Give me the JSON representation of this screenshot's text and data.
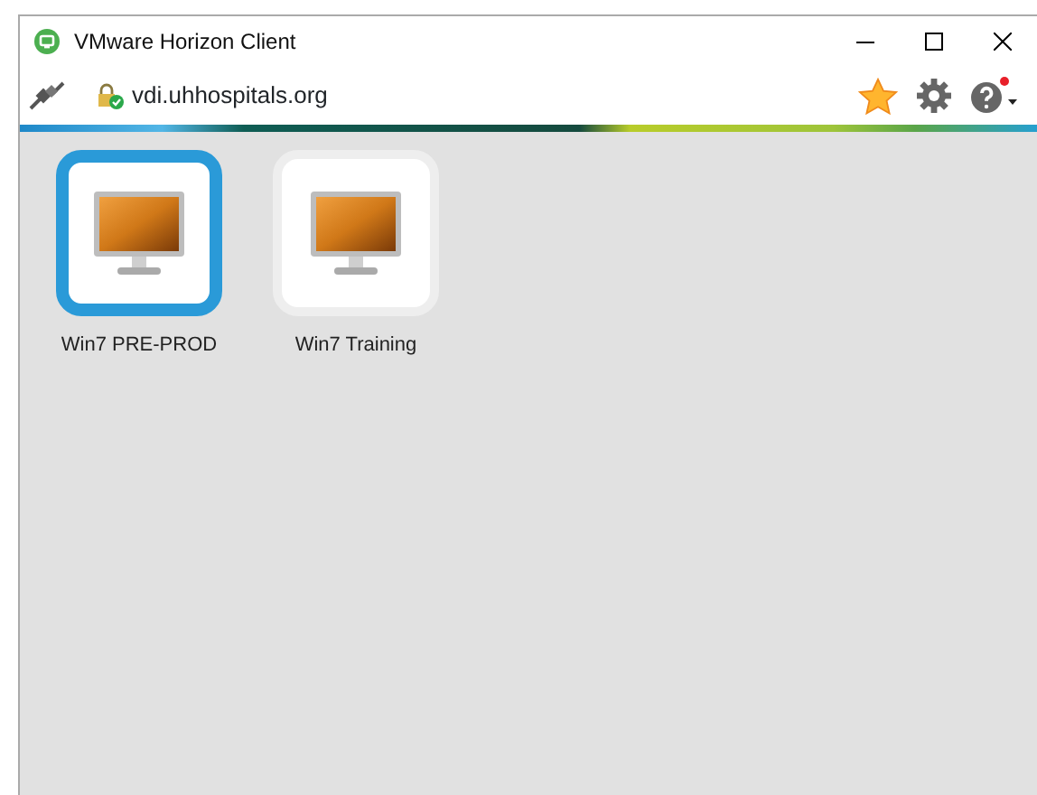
{
  "window": {
    "title": "VMware Horizon Client"
  },
  "toolbar": {
    "server": "vdi.uhhospitals.org",
    "help_notification": true
  },
  "desktops": [
    {
      "name": "Win7 PRE-PROD",
      "selected": true
    },
    {
      "name": "Win7 Training",
      "selected": false
    }
  ]
}
